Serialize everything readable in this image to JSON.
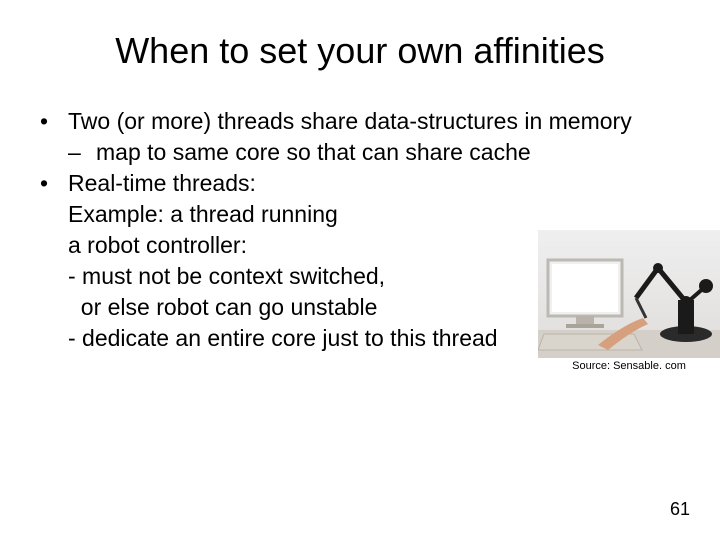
{
  "title": "When to set your own affinities",
  "bullets": {
    "b1": "Two (or more) threads share data-structures in memory",
    "s1": "map to same core so that can share cache",
    "b2": "Real-time threads:",
    "l1": "Example: a thread running",
    "l2": "a robot controller:",
    "l3": "- must not be context switched,",
    "l4": "  or else robot can go unstable",
    "l5": "- dedicate an entire core just to this thread"
  },
  "figure": {
    "caption": "Source: Sensable. com"
  },
  "page_number": "61"
}
